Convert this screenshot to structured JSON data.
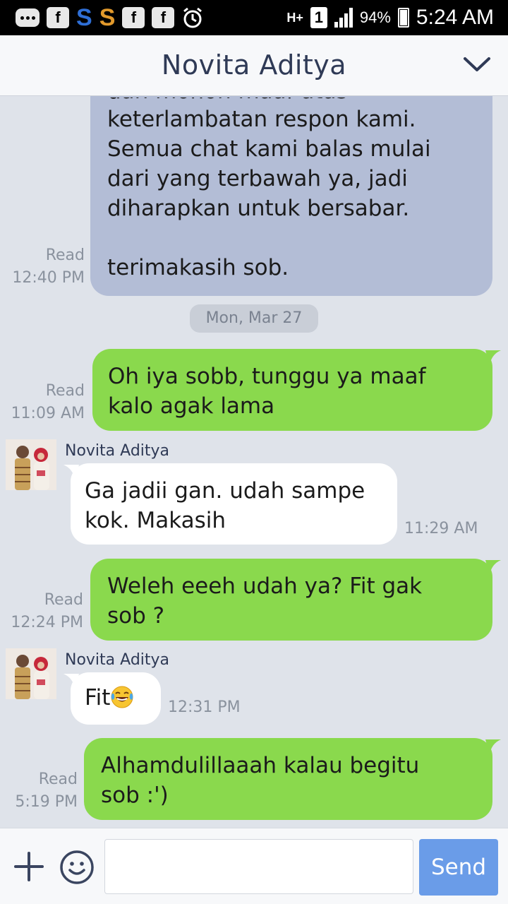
{
  "status_bar": {
    "battery_pct": "94%",
    "time": "5:24 AM",
    "network": "H+",
    "sim_slot": "1",
    "battery_level": 0.94,
    "icons": [
      "bbm-icon",
      "facebook-icon",
      "shazam-icon",
      "swiftkey-icon",
      "facebook-icon",
      "facebook-icon",
      "alarm-icon",
      "data-hplus-icon",
      "sim1-icon",
      "signal-icon",
      "battery-icon"
    ]
  },
  "header": {
    "title": "Novita Aditya",
    "menu_icon": "chevron-down-icon"
  },
  "chat": {
    "date_separator": "Mon, Mar 27",
    "messages": [
      {
        "direction": "incoming",
        "style": "system-gray",
        "partial_line": "dan mohon maaf atas",
        "text_lines": [
          "keterlambatan respon kami.",
          "Semua chat kami balas mulai",
          "dari yang terbawah ya, jadi",
          "diharapkan untuk bersabar.",
          "",
          "terimakasih sob."
        ],
        "read_label": "Read",
        "time": "12:40 PM"
      },
      {
        "direction": "outgoing",
        "text_lines": [
          "Oh iya sobb, tunggu ya maaf",
          "kalo agak lama"
        ],
        "read_label": "Read",
        "time": "11:09 AM"
      },
      {
        "direction": "incoming",
        "sender": "Novita Aditya",
        "text_lines": [
          "Ga jadii gan. udah sampe",
          "kok. Makasih"
        ],
        "time": "11:29 AM"
      },
      {
        "direction": "outgoing",
        "text_lines": [
          "Weleh eeeh udah ya? Fit gak",
          "sob ?"
        ],
        "read_label": "Read",
        "time": "12:24 PM"
      },
      {
        "direction": "incoming",
        "sender": "Novita Aditya",
        "text": "Fit",
        "emoji": "😂",
        "time": "12:31 PM"
      },
      {
        "direction": "outgoing",
        "text_lines": [
          "Alhamdulillaaah kalau begitu",
          "sob :')"
        ],
        "read_label": "Read",
        "time": "5:19 PM"
      }
    ]
  },
  "input_bar": {
    "value": "",
    "placeholder": "",
    "send_label": "Send",
    "plus_icon": "plus-icon",
    "emoji_icon": "emoji-smile-icon"
  },
  "colors": {
    "outgoing_bubble": "#8ad94d",
    "incoming_bubble": "#ffffff",
    "system_bubble": "#b3bdd6",
    "chat_background": "#dfe3ea",
    "send_button": "#6a9ce8",
    "title_text": "#2f3a56"
  }
}
